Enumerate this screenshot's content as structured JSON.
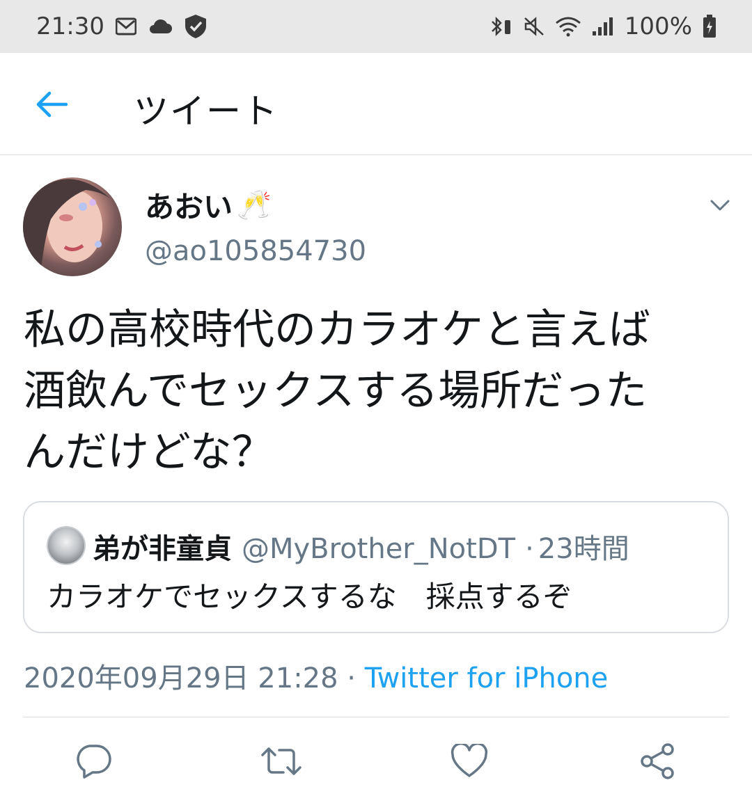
{
  "status_bar": {
    "time": "21:30",
    "battery": "100%"
  },
  "header": {
    "title": "ツイート"
  },
  "tweet": {
    "display_name": "あおい",
    "name_emoji": "🥂",
    "handle": "@ao105854730",
    "text": "私の高校時代のカラオケと言えば\n酒飲んでセックスする場所だった\nんだけどな？",
    "timestamp": "2020年09月29日 21:28",
    "separator": " · ",
    "source": "Twitter for iPhone"
  },
  "quoted_tweet": {
    "name": "弟が非童貞",
    "handle": "@MyBrother_NotDT",
    "separator": "·",
    "age": "23時間",
    "text": "カラオケでセックスするな　採点するぞ"
  },
  "colors": {
    "accent": "#1da1f2",
    "text_primary": "#14171a",
    "text_secondary": "#657786",
    "border": "#d9dde1",
    "icon": "#657786"
  }
}
